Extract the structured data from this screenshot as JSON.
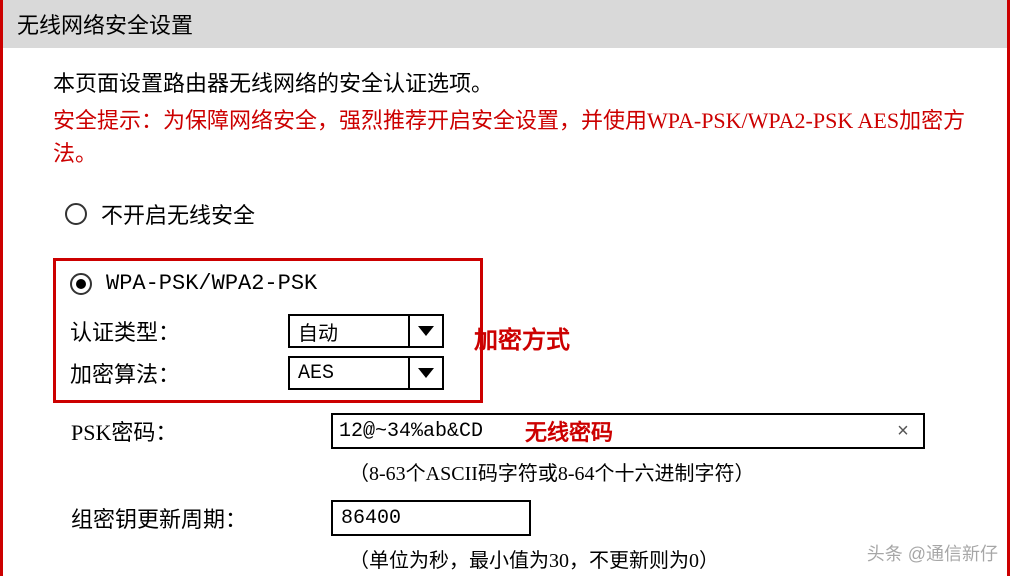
{
  "header": {
    "title": "无线网络安全设置"
  },
  "intro": "本页面设置路由器无线网络的安全认证选项。",
  "warning": "安全提示：为保障网络安全，强烈推荐开启安全设置，并使用WPA-PSK/WPA2-PSK AES加密方法。",
  "options": {
    "disable": {
      "label": "不开启无线安全",
      "checked": false
    },
    "wpa": {
      "label": "WPA-PSK/WPA2-PSK",
      "checked": true
    }
  },
  "fields": {
    "auth_type": {
      "label": "认证类型：",
      "value": "自动"
    },
    "cipher": {
      "label": "加密算法：",
      "value": "AES"
    },
    "psk": {
      "label": "PSK密码：",
      "value": "12@~34%ab&CD",
      "hint": "（8-63个ASCII码字符或8-64个十六进制字符）"
    },
    "rekey": {
      "label": "组密钥更新周期：",
      "value": "86400",
      "hint": "（单位为秒，最小值为30，不更新则为0）"
    }
  },
  "annotations": {
    "cipher_note": "加密方式",
    "psk_note": "无线密码"
  },
  "watermark": "头条 @通信新仔"
}
